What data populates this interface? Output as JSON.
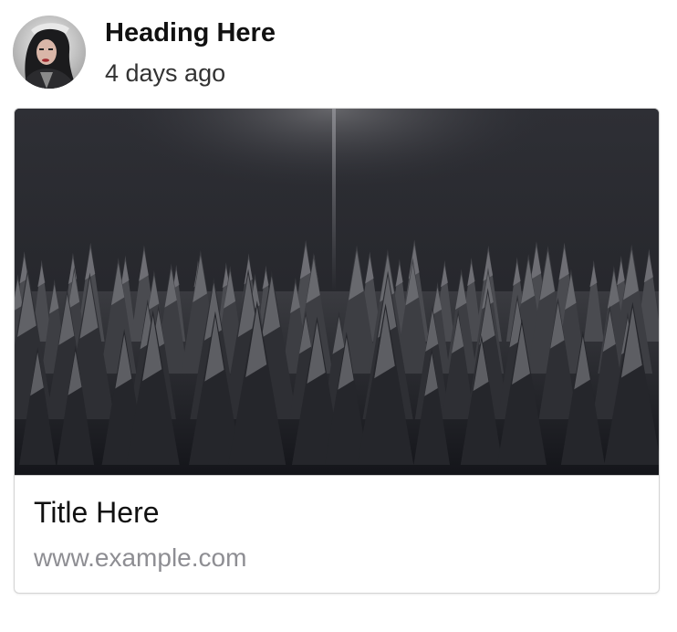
{
  "post": {
    "heading": "Heading Here",
    "timestamp": "4 days ago",
    "avatar_icon": "user-avatar-photo"
  },
  "link_card": {
    "title": "Title Here",
    "url": "www.example.com",
    "image_icon": "snowy-forest-photo"
  }
}
